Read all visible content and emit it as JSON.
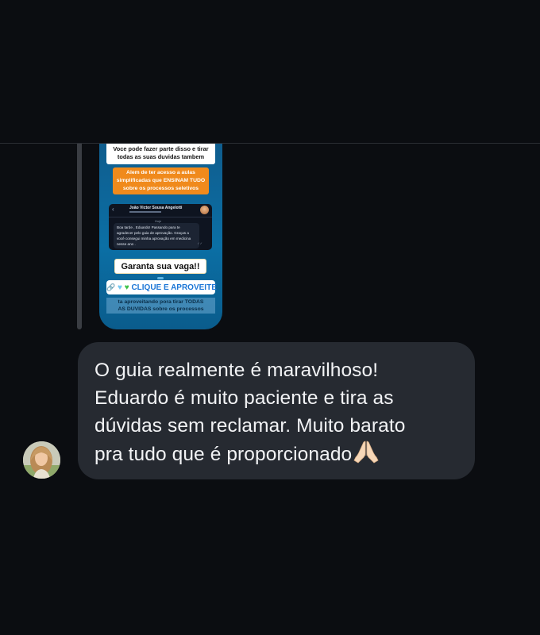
{
  "story_reply": {
    "white_box_lines": [
      "Voce pode fazer parte disso e tirar",
      "todas as suas duvidas tambem"
    ],
    "orange_box_lines": [
      "Alem de ter acesso a aulas",
      "simplificadas que ENSINAM TUDO",
      "sobre os processos seletivos"
    ],
    "chat_preview": {
      "contact_name": "João Victor Sousa Angelotti",
      "time": "Hoje",
      "message": "Boa tarde , Eduardo! Passando para te agradecer pelo guia de aprovação. Graças a você consegui minha aprovação em medicina nesse ano ."
    },
    "cta_label": "Garanta sua vaga!!",
    "link_sticker_label": "CLIQUE E APROVEITE",
    "bottom_text_lines": [
      "ta aproveitando pora tirar TODAS",
      "AS DUVIDAS sobre os processos"
    ]
  },
  "message": {
    "lines": [
      "O guia realmente é maravilhoso!",
      "Eduardo é muito paciente e tira as",
      "dúvidas sem reclamar. Muito barato",
      "pra tudo que é proporcionado"
    ],
    "emoji": "folded-hands"
  },
  "colors": {
    "background": "#0b0d11",
    "bubble": "#262a31",
    "bubble_text": "#f2f3f5",
    "story_blue": "#0b6fa5",
    "story_orange": "#f08a1c"
  }
}
